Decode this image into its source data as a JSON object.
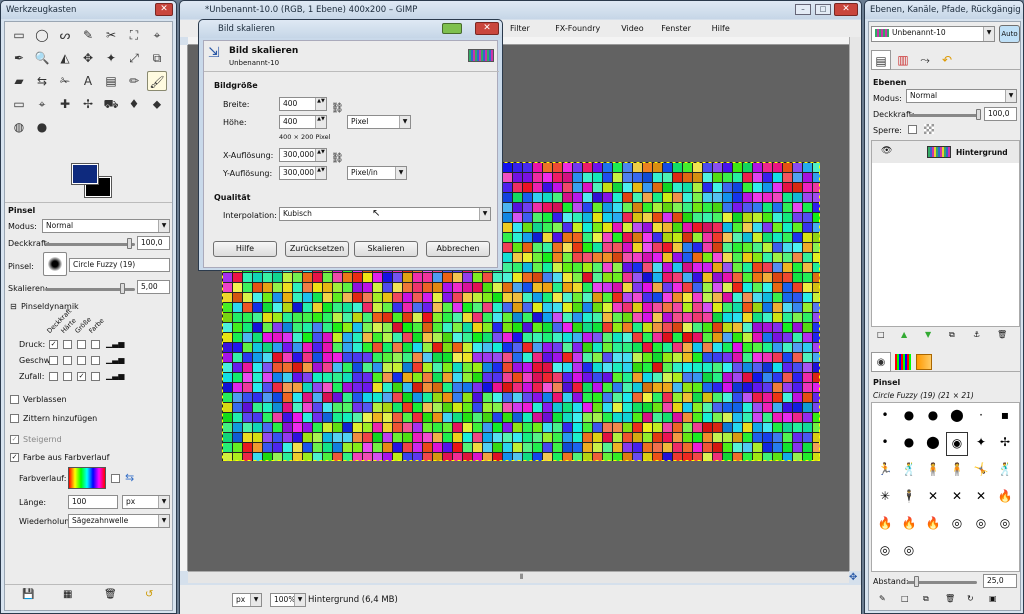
{
  "toolbox": {
    "title": "Werkzeugkasten",
    "tools": [
      "▭",
      "◯",
      "ᔕ",
      "✎",
      "✂",
      "⛶",
      "⌖",
      "✒",
      "🔍",
      "◭",
      "✥",
      "✦",
      "⤢",
      "⧉",
      "▰",
      "⇆",
      "✁",
      "A",
      "▤",
      "✏",
      "🖌",
      "▭",
      "⌖",
      "✚",
      "✢",
      "⛟",
      "♦",
      "⬥",
      "◍",
      "●"
    ],
    "brush_title": "Pinsel",
    "mode_label": "Modus:",
    "mode_value": "Normal",
    "opacity_label": "Deckkraft:",
    "opacity_value": "100,0",
    "brush_label": "Pinsel:",
    "brush_value": "Circle Fuzzy (19)",
    "scale_label": "Skalieren:",
    "scale_value": "5,00",
    "dynamics_label": "Pinseldynamik",
    "dyn_cols": [
      "Deckkraft",
      "Härte",
      "Größe",
      "Farbe"
    ],
    "dyn_rows": [
      {
        "label": "Druck:",
        "checks": [
          true,
          false,
          false,
          false
        ]
      },
      {
        "label": "Geschw.:",
        "checks": [
          false,
          false,
          false,
          false
        ]
      },
      {
        "label": "Zufall:",
        "checks": [
          false,
          false,
          true,
          false
        ]
      }
    ],
    "fade_label": "Verblassen",
    "jitter_label": "Zittern hinzufügen",
    "incremental_label": "Steigernd",
    "gradient_color_label": "Farbe aus Farbverlauf",
    "gradient_label": "Farbverlauf:",
    "length_label": "Länge:",
    "length_value": "100",
    "length_unit": "px",
    "repeat_label": "Wiederholung:",
    "repeat_value": "Sägezahnwelle"
  },
  "main": {
    "title": "*Unbenannt-10.0 (RGB, 1 Ebene) 400x200 – GIMP",
    "menus": [
      "Filter",
      "FX-Foundry",
      "Video",
      "Fenster",
      "Hilfe"
    ],
    "unit": "px",
    "zoom": "100%",
    "status": "Hintergrund (6,4 MB)"
  },
  "dialog": {
    "title": "Bild skalieren",
    "heading": "Bild skalieren",
    "subheading": "Unbenannt-10",
    "size_section": "Bildgröße",
    "width_label": "Breite:",
    "width_value": "400",
    "height_label": "Höhe:",
    "height_value": "400",
    "size_info": "400 × 200 Pixel",
    "unit_value": "Pixel",
    "xres_label": "X-Auflösung:",
    "xres_value": "300,000",
    "yres_label": "Y-Auflösung:",
    "yres_value": "300,000",
    "res_unit": "Pixel/in",
    "quality_section": "Qualität",
    "interp_label": "Interpolation:",
    "interp_value": "Kubisch",
    "buttons": [
      "Hilfe",
      "Zurücksetzen",
      "Skalieren",
      "Abbrechen"
    ]
  },
  "layers": {
    "title": "Ebenen, Kanäle, Pfade, Rückgängig …",
    "image_name": "Unbenannt-10",
    "auto_label": "Auto",
    "section": "Ebenen",
    "mode_label": "Modus:",
    "mode_value": "Normal",
    "opacity_label": "Deckkraft:",
    "opacity_value": "100,0",
    "lock_label": "Sperre:",
    "layer_name": "Hintergrund",
    "brushes_section": "Pinsel",
    "brush_name": "Circle Fuzzy (19) (21 × 21)",
    "spacing_label": "Abstand:",
    "spacing_value": "25,0"
  }
}
